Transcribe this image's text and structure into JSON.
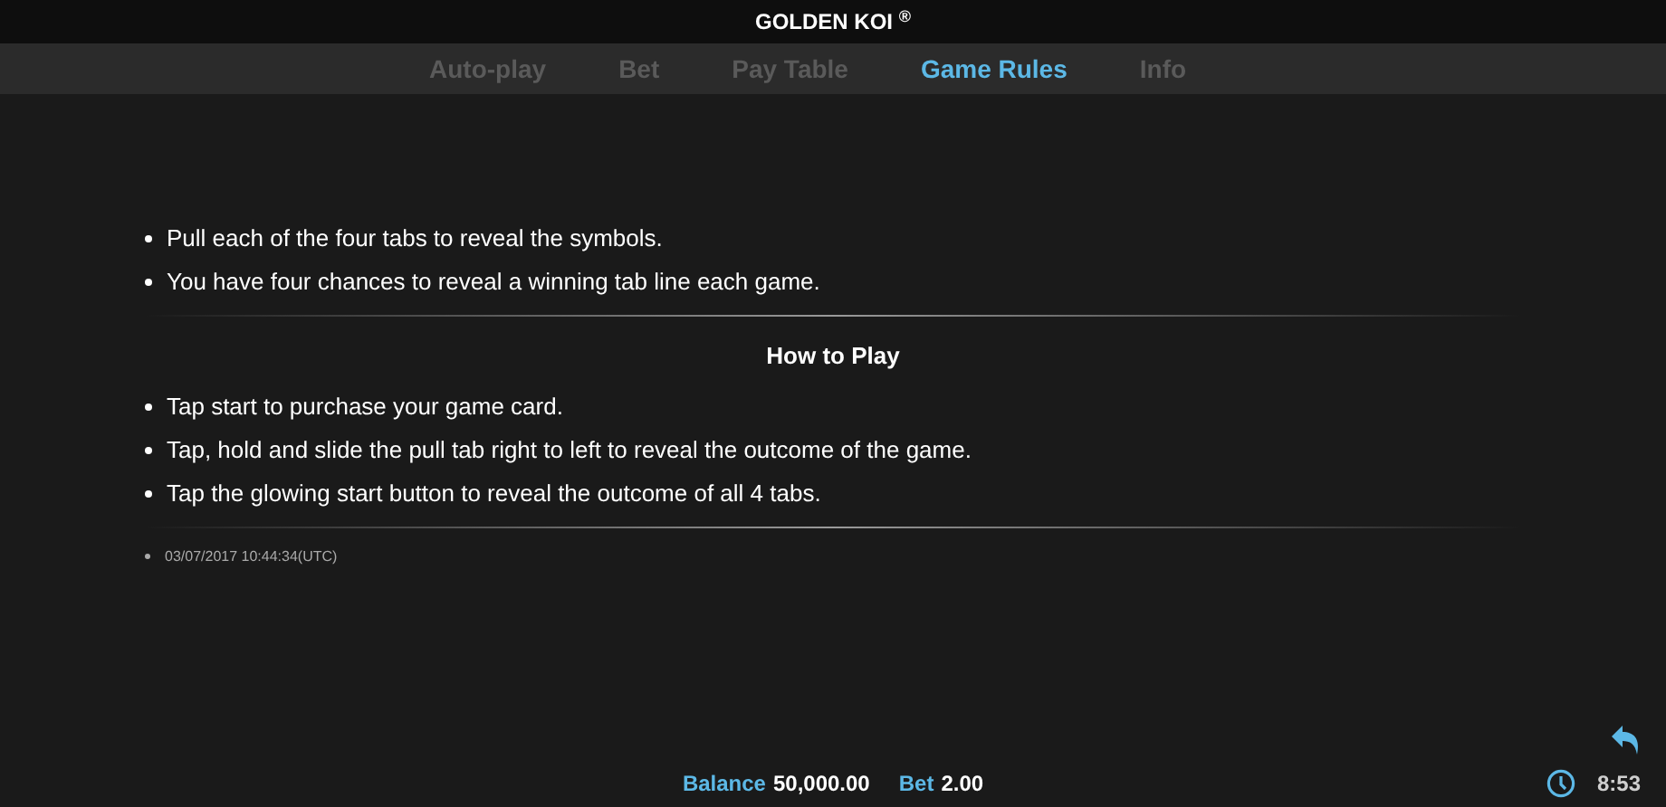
{
  "window": {
    "title": "GOLDEN KOI $^{®}$"
  },
  "tabs": [
    {
      "label": "Auto-play",
      "selected": false
    },
    {
      "label": "Bet",
      "selected": false
    },
    {
      "label": "Pay Table",
      "selected": false
    },
    {
      "label": "Game Rules",
      "selected": true
    },
    {
      "label": "Info",
      "selected": false
    }
  ],
  "rules": [
    "Pull each of the four tabs to reveal the symbols.",
    "You have four chances to reveal a winning tab line each game."
  ],
  "how_to_play": {
    "heading": "How to Play",
    "items": [
      "Tap start to purchase your game card.",
      "Tap, hold and slide the pull tab right to left to reveal the outcome of the game.",
      "Tap the glowing start button to reveal the outcome of all 4 tabs."
    ]
  },
  "timestamp": "03/07/2017 10:44:34(UTC)",
  "status_bar": {
    "balance_label": "Balance",
    "balance": "50,000.00",
    "bet_label": "Bet",
    "bet": "2.00",
    "time": "8:53"
  }
}
